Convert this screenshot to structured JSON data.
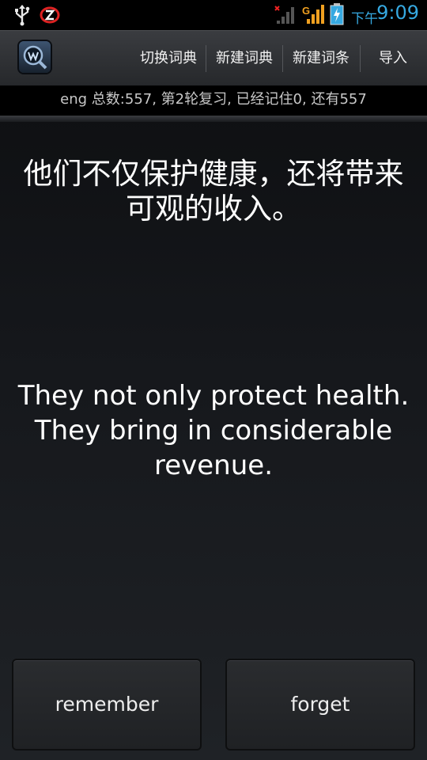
{
  "status_bar": {
    "time_prefix": "下午",
    "time": "9:09",
    "signal_label": "G",
    "icons": [
      "usb-icon",
      "notification-z-icon",
      "no-signal-icon",
      "cell-signal-icon",
      "battery-charging-icon"
    ],
    "accent": "#36a9e1"
  },
  "action_bar": {
    "menu": [
      {
        "label": "切换词典"
      },
      {
        "label": "新建词典"
      },
      {
        "label": "新建词条"
      },
      {
        "label": "导入"
      }
    ]
  },
  "info": {
    "summary": "eng 总数:557, 第2轮复习, 已经记住0, 还有557"
  },
  "card": {
    "question": "他们不仅保护健康，还将带来可观的收入。",
    "answer": "They not only protect health. They bring in considerable revenue."
  },
  "buttons": {
    "remember": "remember",
    "forget": "forget"
  }
}
